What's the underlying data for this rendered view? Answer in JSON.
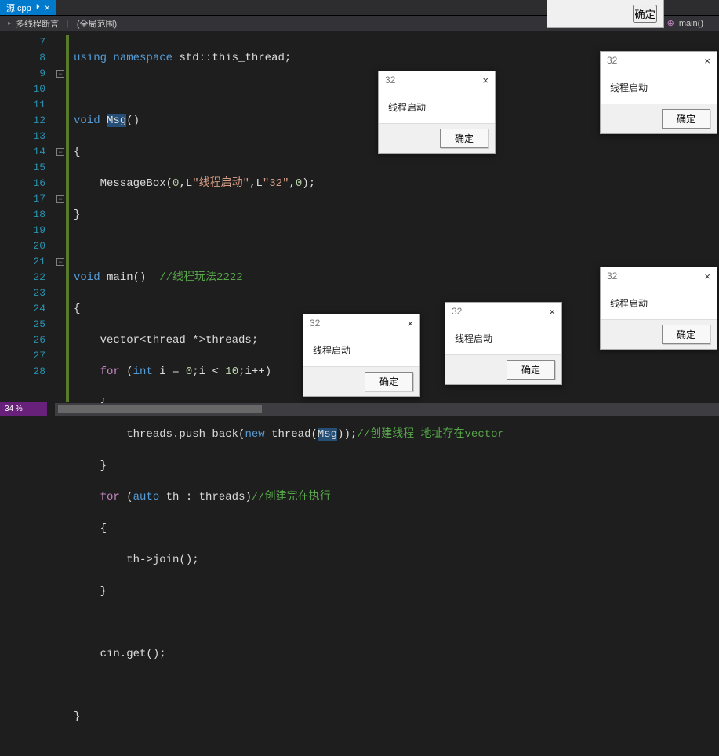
{
  "tab": {
    "label": "源.cpp",
    "close": "×",
    "pin": "⏵"
  },
  "breadcrumb": {
    "project": "多线程断言",
    "scope": "(全局范围)",
    "func": "main()"
  },
  "line_numbers": [
    "7",
    "8",
    "9",
    "10",
    "11",
    "12",
    "13",
    "14",
    "15",
    "16",
    "17",
    "18",
    "19",
    "20",
    "21",
    "22",
    "23",
    "24",
    "25",
    "26",
    "27",
    "28"
  ],
  "code": {
    "l7a": "using",
    "l7b": " ",
    "l7c": "namespace",
    "l7d": " std::this_thread;",
    "l9a": "void",
    "l9b": " ",
    "l9c": "Msg",
    "l9d": "()",
    "l10": "{",
    "l11a": "    MessageBox(",
    "l11b": "0",
    "l11c": ",L",
    "l11d": "\"线程启动\"",
    "l11e": ",L",
    "l11f": "\"32\"",
    "l11g": ",",
    "l11h": "0",
    "l11i": ");",
    "l12": "}",
    "l14a": "void",
    "l14b": " main()  ",
    "l14c": "//线程玩法2222",
    "l15": "{",
    "l16a": "    vector<thread *>threads;",
    "l17a": "    ",
    "l17b": "for",
    "l17c": " (",
    "l17d": "int",
    "l17e": " i = ",
    "l17f": "0",
    "l17g": ";i < ",
    "l17h": "10",
    "l17i": ";i++)",
    "l18": "    {",
    "l19a": "        threads.push_back(",
    "l19b": "new",
    "l19c": " thread(",
    "l19d": "Msg",
    "l19e": "));",
    "l19f": "//创建线程 地址存在vector",
    "l20": "    }",
    "l21a": "    ",
    "l21b": "for",
    "l21c": " (",
    "l21d": "auto",
    "l21e": " th : threads)",
    "l21f": "//创建完在执行",
    "l22": "    {",
    "l23": "        th->join();",
    "l24": "    }",
    "l26": "    cin.get();",
    "l28": "}"
  },
  "msgbox": {
    "title": "32",
    "text": "线程启动",
    "ok": "确定",
    "close": "×"
  },
  "zoom": "34 %"
}
